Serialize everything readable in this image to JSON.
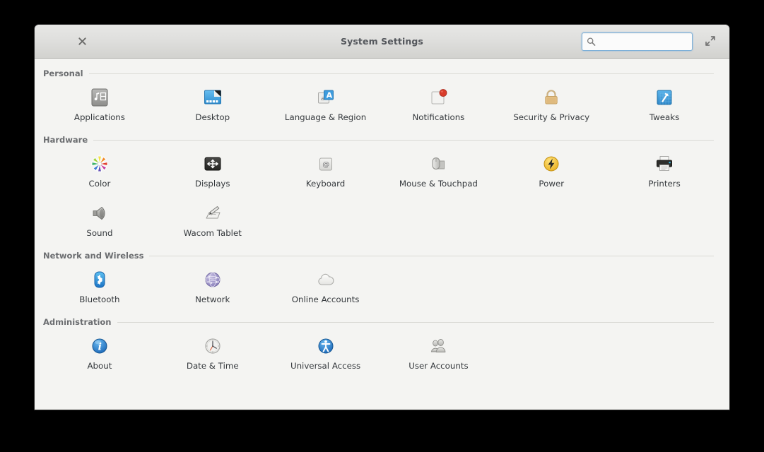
{
  "window": {
    "title": "System Settings",
    "close_icon": "close-icon",
    "maximize_icon": "maximize-icon"
  },
  "search": {
    "value": "",
    "placeholder": "",
    "icon": "search-icon"
  },
  "groups": [
    {
      "title": "Personal",
      "items": [
        {
          "label": "Applications",
          "icon": "applications-icon"
        },
        {
          "label": "Desktop",
          "icon": "desktop-icon"
        },
        {
          "label": "Language & Region",
          "icon": "language-region-icon"
        },
        {
          "label": "Notifications",
          "icon": "notifications-icon"
        },
        {
          "label": "Security & Privacy",
          "icon": "security-privacy-icon"
        },
        {
          "label": "Tweaks",
          "icon": "tweaks-icon"
        }
      ]
    },
    {
      "title": "Hardware",
      "items": [
        {
          "label": "Color",
          "icon": "color-icon"
        },
        {
          "label": "Displays",
          "icon": "displays-icon"
        },
        {
          "label": "Keyboard",
          "icon": "keyboard-icon"
        },
        {
          "label": "Mouse & Touchpad",
          "icon": "mouse-touchpad-icon"
        },
        {
          "label": "Power",
          "icon": "power-icon"
        },
        {
          "label": "Printers",
          "icon": "printers-icon"
        },
        {
          "label": "Sound",
          "icon": "sound-icon"
        },
        {
          "label": "Wacom Tablet",
          "icon": "wacom-tablet-icon"
        }
      ]
    },
    {
      "title": "Network and Wireless",
      "items": [
        {
          "label": "Bluetooth",
          "icon": "bluetooth-icon"
        },
        {
          "label": "Network",
          "icon": "network-icon"
        },
        {
          "label": "Online Accounts",
          "icon": "online-accounts-icon"
        }
      ]
    },
    {
      "title": "Administration",
      "items": [
        {
          "label": "About",
          "icon": "about-icon"
        },
        {
          "label": "Date & Time",
          "icon": "date-time-icon"
        },
        {
          "label": "Universal Access",
          "icon": "universal-access-icon"
        },
        {
          "label": "User Accounts",
          "icon": "user-accounts-icon"
        }
      ]
    }
  ],
  "colors": {
    "accent_blue": "#2f8fd6",
    "notification_red": "#d93c2b",
    "power_yellow": "#f2c230",
    "lock_tan": "#e2bb7a",
    "network_purple": "#9b8fc4",
    "titlebar_text": "#54575c",
    "group_title": "#6b6d70",
    "label_text": "#35393d",
    "window_bg": "#f4f4f2"
  }
}
